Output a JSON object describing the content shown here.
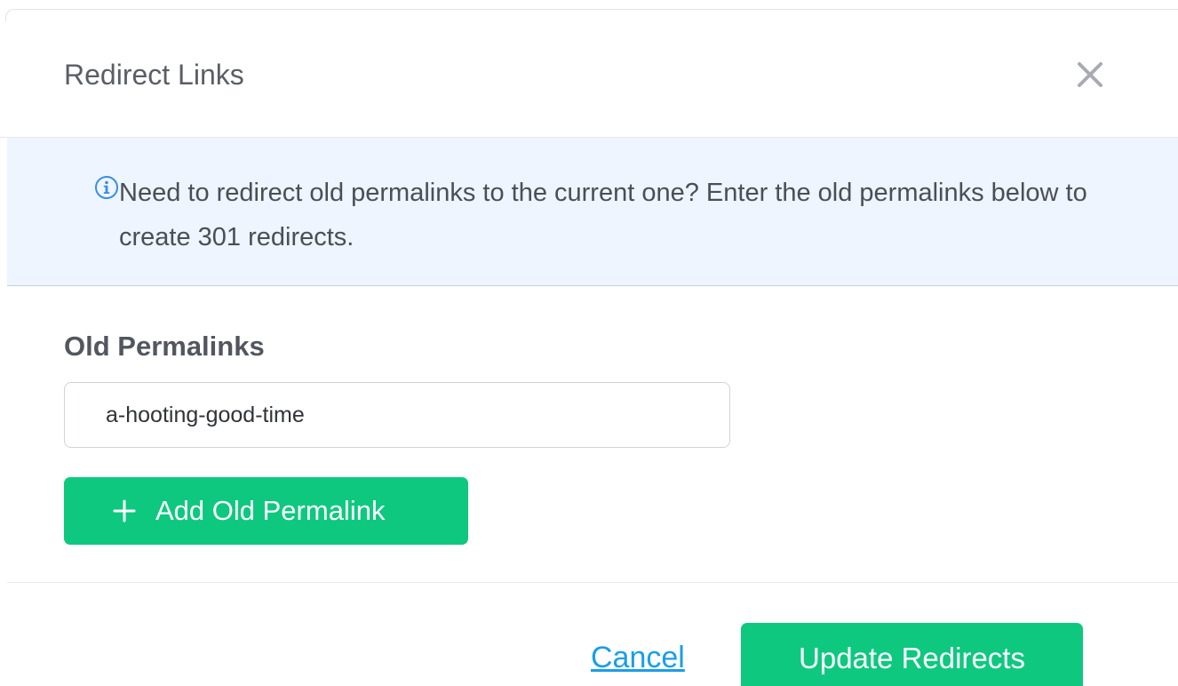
{
  "modal": {
    "title": "Redirect Links",
    "close_icon": "close-icon"
  },
  "notice": {
    "icon": "info-icon",
    "text": "Need to redirect old permalinks to the current one? Enter the old permalinks below to create 301 redirects."
  },
  "form": {
    "label": "Old Permalinks",
    "permalinks": [
      "a-hooting-good-time"
    ],
    "add_button_icon": "plus-icon",
    "add_button_label": "Add Old Permalink"
  },
  "footer": {
    "cancel_label": "Cancel",
    "submit_label": "Update Redirects"
  },
  "colors": {
    "accent_green": "#0ec880",
    "link_blue": "#1a9ee8",
    "notice_background": "#eef5fe"
  }
}
